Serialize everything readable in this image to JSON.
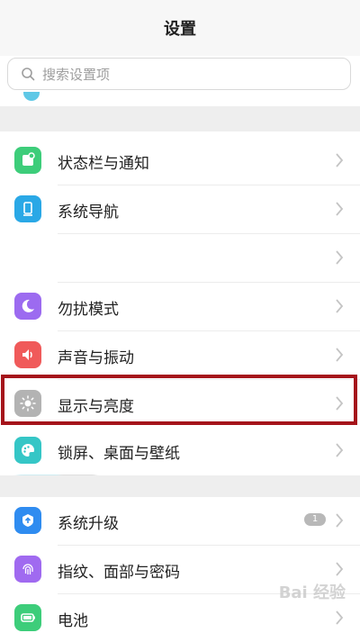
{
  "header": {
    "title": "设置"
  },
  "search": {
    "placeholder": "搜索设置项"
  },
  "group1": [
    {
      "label": "状态栏与通知",
      "icon": "notification-bar-icon",
      "color": "#3dcd7a"
    },
    {
      "label": "系统导航",
      "icon": "navigation-icon",
      "color": "#2aa8e6"
    },
    {
      "label": "",
      "icon": "blurred-icon",
      "color": "#bfe6ee"
    },
    {
      "label": "勿扰模式",
      "icon": "moon-icon",
      "color": "#9c6bf0"
    },
    {
      "label": "声音与振动",
      "icon": "speaker-icon",
      "color": "#f05a5a"
    },
    {
      "label": "显示与亮度",
      "icon": "sun-icon",
      "color": "#b3b3b3"
    },
    {
      "label": "锁屏、桌面与壁纸",
      "icon": "palette-icon",
      "color": "#35c6c6"
    }
  ],
  "group2": [
    {
      "label": "系统升级",
      "icon": "update-icon",
      "color": "#2f8cf0",
      "badge": "1"
    },
    {
      "label": "指纹、面部与密码",
      "icon": "fingerprint-icon",
      "color": "#a06af0"
    },
    {
      "label": "电池",
      "icon": "battery-icon",
      "color": "#3dcd7a"
    }
  ],
  "watermark": "Bai 经验"
}
